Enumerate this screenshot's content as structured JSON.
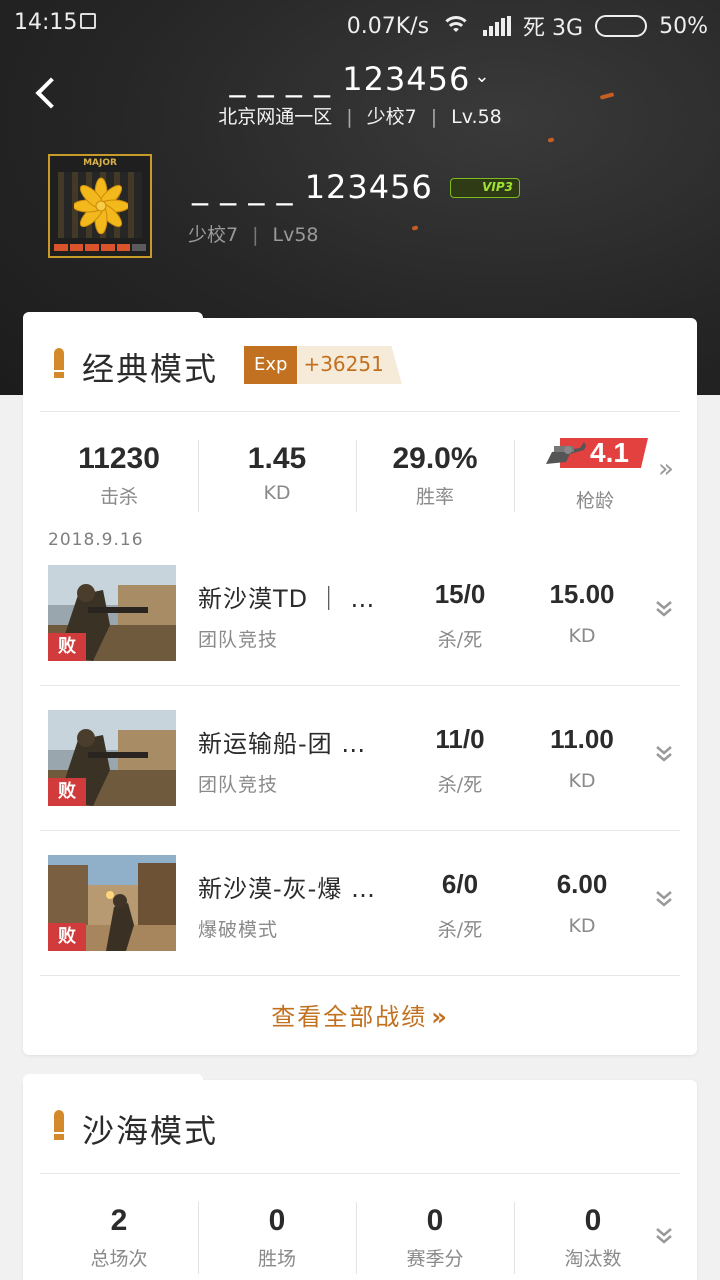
{
  "status_bar": {
    "time": "14:15",
    "network_speed": "0.07K/s",
    "carrier": "死 3G",
    "battery": "50%"
  },
  "header": {
    "title": "_ _ _ _ 123456",
    "server": "北京网通一区",
    "rank": "少校7",
    "level": "Lv.58"
  },
  "profile": {
    "badge_label": "MAJOR",
    "name": "_ _ _ _ 123456",
    "vip": "VIP3",
    "rank": "少校7",
    "level": "Lv58",
    "rank_progress": 0.83
  },
  "classic": {
    "title": "经典模式",
    "exp_label": "Exp",
    "exp_value": "+36251",
    "stats": [
      {
        "value": "11230",
        "label": "击杀"
      },
      {
        "value": "1.45",
        "label": "KD"
      },
      {
        "value": "29.0%",
        "label": "胜率"
      }
    ],
    "gun_age": {
      "value": "4.1",
      "label": "枪龄"
    },
    "date": "2018.9.16",
    "matches": [
      {
        "name": "新沙漠TD ｜ …",
        "mode": "团队竞技",
        "kd": "15/0",
        "kd_label": "杀/死",
        "ratio": "15.00",
        "ratio_label": "KD",
        "result": "败"
      },
      {
        "name": "新运输船-团 …",
        "mode": "团队竞技",
        "kd": "11/0",
        "kd_label": "杀/死",
        "ratio": "11.00",
        "ratio_label": "KD",
        "result": "败"
      },
      {
        "name": "新沙漠-灰-爆 …",
        "mode": "爆破模式",
        "kd": "6/0",
        "kd_label": "杀/死",
        "ratio": "6.00",
        "ratio_label": "KD",
        "result": "败"
      }
    ],
    "view_all": "查看全部战绩"
  },
  "sand": {
    "title": "沙海模式",
    "stats": [
      {
        "value": "2",
        "label": "总场次"
      },
      {
        "value": "0",
        "label": "胜场"
      },
      {
        "value": "0",
        "label": "赛季分"
      },
      {
        "value": "0",
        "label": "淘汰数"
      }
    ]
  },
  "colors": {
    "accent": "#c1711f",
    "lose": "#d23b3b",
    "gun_flag": "#e34040",
    "vip_green": "#7dbb1e"
  }
}
